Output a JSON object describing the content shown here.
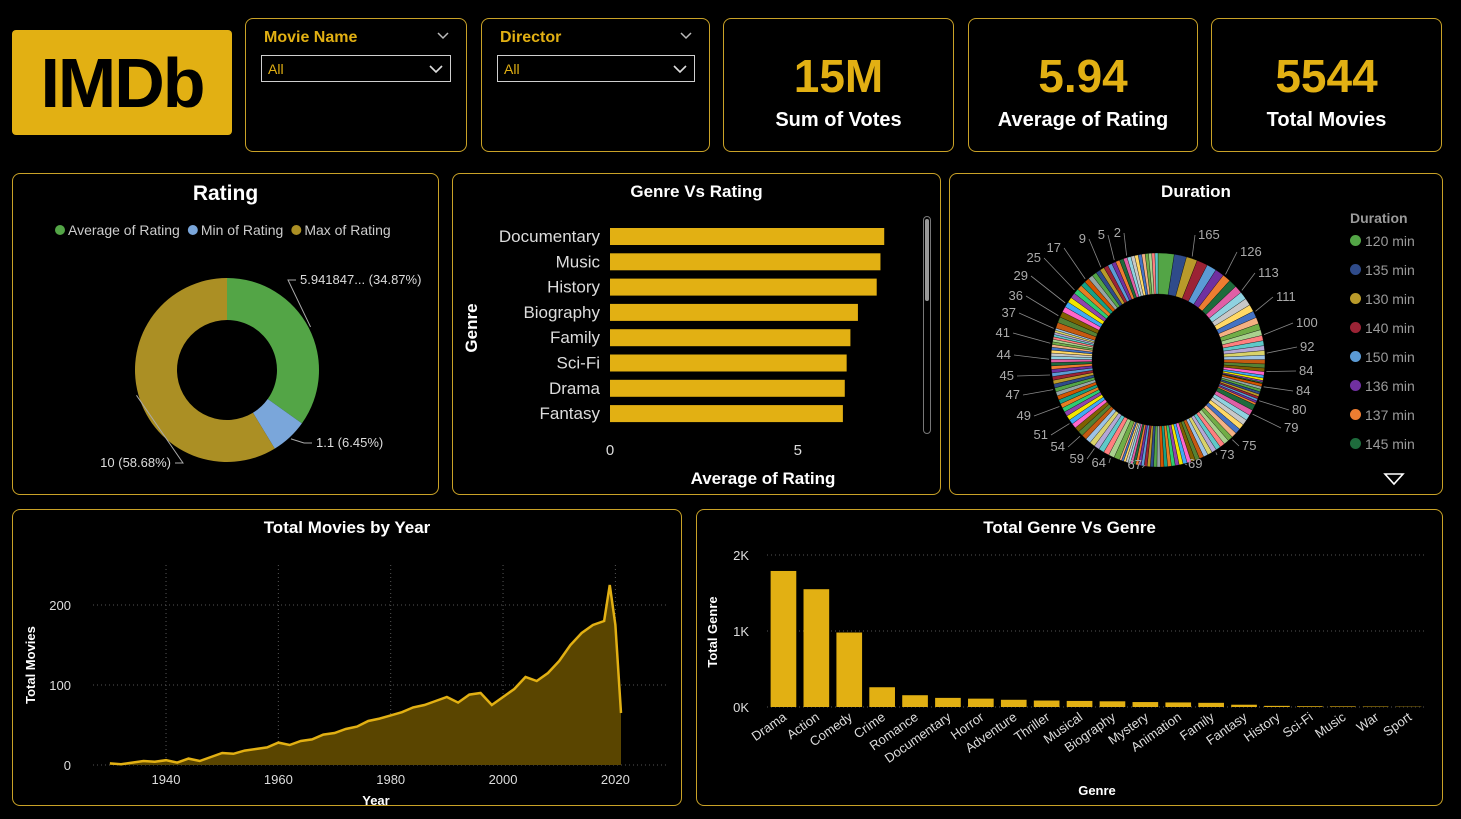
{
  "logo": {
    "text": "IMDb"
  },
  "slicers": {
    "movie": {
      "label": "Movie Name",
      "value": "All"
    },
    "director": {
      "label": "Director",
      "value": "All"
    }
  },
  "kpis": {
    "votes": {
      "value": "15M",
      "label": "Sum of Votes"
    },
    "rating": {
      "value": "5.94",
      "label": "Average of Rating"
    },
    "movies": {
      "value": "5544",
      "label": "Total Movies"
    }
  },
  "colors": {
    "accent": "#e2b013",
    "border": "#c9a227",
    "bg": "#000000"
  },
  "rating_panel": {
    "title": "Rating",
    "legend": [
      {
        "label": "Average of Rating",
        "color": "#53a546"
      },
      {
        "label": "Min of Rating",
        "color": "#7aa6da"
      },
      {
        "label": "Max of Rating",
        "color": "#ab8f24"
      }
    ],
    "labels": {
      "avg": "5.941847... (34.87%)",
      "min": "1.1 (6.45%)",
      "max": "10 (58.68%)"
    }
  },
  "genre_rating_panel": {
    "title": "Genre Vs Rating",
    "ylabel": "Genre",
    "xlabel": "Average of Rating",
    "ticks": [
      "0",
      "5"
    ]
  },
  "duration_panel": {
    "title": "Duration",
    "legend_title": "Duration",
    "legend": [
      {
        "label": "120 min",
        "color": "#53a546"
      },
      {
        "label": "135 min",
        "color": "#2f4b8a"
      },
      {
        "label": "130 min",
        "color": "#b99a2a"
      },
      {
        "label": "140 min",
        "color": "#9b2335"
      },
      {
        "label": "150 min",
        "color": "#5b9bd5"
      },
      {
        "label": "136 min",
        "color": "#7030a0"
      },
      {
        "label": "137 min",
        "color": "#ed7d31"
      },
      {
        "label": "145 min",
        "color": "#1e6b3c"
      }
    ],
    "outer_labels": [
      "165",
      "126",
      "113",
      "111",
      "100",
      "92",
      "84",
      "84",
      "80",
      "79",
      "75",
      "73",
      "69",
      "67",
      "64",
      "59",
      "54",
      "51",
      "49",
      "47",
      "45",
      "44",
      "41",
      "37",
      "36",
      "29",
      "25",
      "17",
      "9",
      "5",
      "2"
    ]
  },
  "year_panel": {
    "title": "Total Movies by Year",
    "xlabel": "Year",
    "ylabel": "Total Movies"
  },
  "genre_count_panel": {
    "title": "Total Genre Vs Genre",
    "xlabel": "Genre",
    "ylabel": "Total Genre"
  },
  "chart_data": [
    {
      "type": "pie",
      "title": "Rating",
      "categories": [
        "Average of Rating",
        "Min of Rating",
        "Max of Rating"
      ],
      "values": [
        5.94,
        1.1,
        10
      ]
    },
    {
      "type": "bar",
      "title": "Genre Vs Rating",
      "orientation": "horizontal",
      "categories": [
        "Documentary",
        "Music",
        "History",
        "Biography",
        "Family",
        "Sci-Fi",
        "Drama",
        "Fantasy"
      ],
      "values": [
        7.3,
        7.2,
        7.1,
        6.6,
        6.4,
        6.3,
        6.25,
        6.2
      ],
      "xlabel": "Average of Rating",
      "ylabel": "Genre",
      "xlim": [
        0,
        7.8
      ]
    },
    {
      "type": "pie",
      "title": "Duration",
      "categories": [
        "120 min",
        "135 min",
        "130 min",
        "140 min",
        "150 min",
        "136 min",
        "137 min",
        "145 min"
      ],
      "values": [
        165,
        126,
        113,
        111,
        100,
        92,
        84,
        84
      ]
    },
    {
      "type": "area",
      "title": "Total Movies by Year",
      "xlabel": "Year",
      "ylabel": "Total Movies",
      "xlim": [
        1930,
        2021
      ],
      "ylim": [
        0,
        250
      ],
      "x": [
        1930,
        1932,
        1934,
        1936,
        1938,
        1940,
        1942,
        1944,
        1946,
        1948,
        1950,
        1952,
        1954,
        1956,
        1958,
        1960,
        1962,
        1964,
        1966,
        1968,
        1970,
        1972,
        1974,
        1976,
        1978,
        1980,
        1982,
        1984,
        1986,
        1988,
        1990,
        1992,
        1994,
        1996,
        1998,
        2000,
        2002,
        2004,
        2006,
        2008,
        2010,
        2012,
        2014,
        2016,
        2018,
        2019,
        2020,
        2021
      ],
      "y": [
        2,
        1,
        3,
        5,
        4,
        6,
        3,
        8,
        5,
        10,
        15,
        14,
        18,
        20,
        22,
        28,
        25,
        30,
        32,
        38,
        40,
        45,
        48,
        55,
        58,
        62,
        66,
        72,
        75,
        80,
        85,
        78,
        88,
        90,
        75,
        85,
        95,
        110,
        105,
        115,
        130,
        150,
        165,
        175,
        180,
        225,
        175,
        65
      ]
    },
    {
      "type": "bar",
      "title": "Total Genre Vs Genre",
      "xlabel": "Genre",
      "ylabel": "Total Genre",
      "ylim": [
        0,
        2000
      ],
      "yticks": [
        "0K",
        "1K",
        "2K"
      ],
      "categories": [
        "Drama",
        "Action",
        "Comedy",
        "Crime",
        "Romance",
        "Documentary",
        "Horror",
        "Adventure",
        "Thriller",
        "Musical",
        "Biography",
        "Mystery",
        "Animation",
        "Family",
        "Fantasy",
        "History",
        "Sci-Fi",
        "Music",
        "War",
        "Sport"
      ],
      "values": [
        1790,
        1550,
        980,
        260,
        155,
        120,
        110,
        95,
        85,
        80,
        75,
        65,
        60,
        55,
        30,
        15,
        10,
        8,
        6,
        4
      ]
    }
  ]
}
